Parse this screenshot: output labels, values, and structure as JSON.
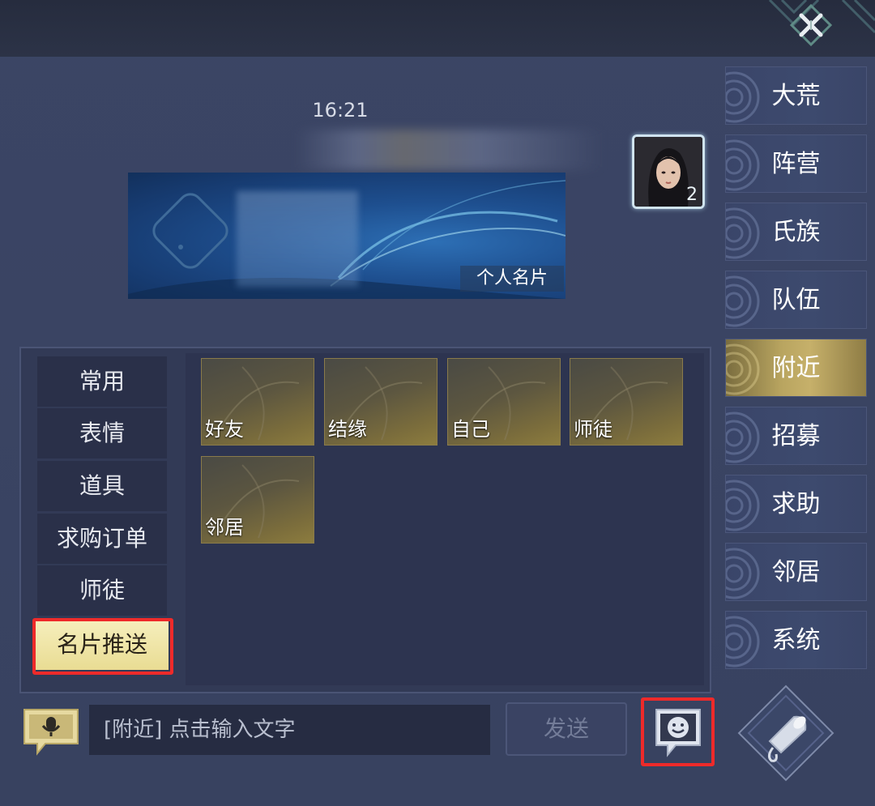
{
  "chat": {
    "timestamp": "16:21",
    "card_label": "个人名片"
  },
  "left_tabs": [
    {
      "label": "常用"
    },
    {
      "label": "表情"
    },
    {
      "label": "道具"
    },
    {
      "label": "求购订单"
    },
    {
      "label": "师徒"
    },
    {
      "label": "名片推送"
    }
  ],
  "active_left_tab": "名片推送",
  "card_tiles": [
    {
      "label": "好友"
    },
    {
      "label": "结缘"
    },
    {
      "label": "自己"
    },
    {
      "label": "师徒"
    },
    {
      "label": "邻居"
    }
  ],
  "right_tabs": [
    {
      "label": "大荒"
    },
    {
      "label": "阵营"
    },
    {
      "label": "氏族"
    },
    {
      "label": "队伍"
    },
    {
      "label": "附近"
    },
    {
      "label": "招募"
    },
    {
      "label": "求助"
    },
    {
      "label": "邻居"
    },
    {
      "label": "系统"
    }
  ],
  "active_right_tab": "附近",
  "input": {
    "placeholder": "[附近]  点击输入文字"
  },
  "send_label": "发送",
  "colors": {
    "highlight": "#ee2a2a",
    "active_tab_gold": "#c6b06a",
    "active_left_tab": "#f0e6a6"
  },
  "icons": {
    "close": "close-icon",
    "voice": "microphone-icon",
    "emoji": "smiley-icon",
    "horn": "horn-icon"
  }
}
